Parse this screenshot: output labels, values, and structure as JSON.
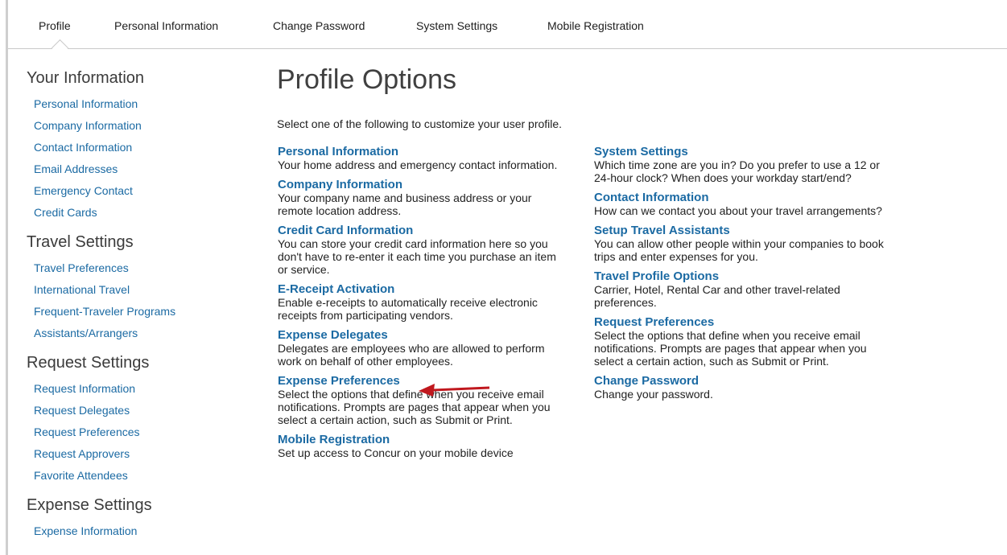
{
  "tabs": [
    {
      "label": "Profile"
    },
    {
      "label": "Personal Information"
    },
    {
      "label": "Change Password"
    },
    {
      "label": "System Settings"
    },
    {
      "label": "Mobile Registration"
    }
  ],
  "sidebar": {
    "groups": [
      {
        "heading": "Your Information",
        "items": [
          {
            "label": "Personal Information"
          },
          {
            "label": "Company Information"
          },
          {
            "label": "Contact Information"
          },
          {
            "label": "Email Addresses"
          },
          {
            "label": "Emergency Contact"
          },
          {
            "label": "Credit Cards"
          }
        ]
      },
      {
        "heading": "Travel Settings",
        "items": [
          {
            "label": "Travel Preferences"
          },
          {
            "label": "International Travel"
          },
          {
            "label": "Frequent-Traveler Programs"
          },
          {
            "label": "Assistants/Arrangers"
          }
        ]
      },
      {
        "heading": "Request Settings",
        "items": [
          {
            "label": "Request Information"
          },
          {
            "label": "Request Delegates"
          },
          {
            "label": "Request Preferences"
          },
          {
            "label": "Request Approvers"
          },
          {
            "label": "Favorite Attendees"
          }
        ]
      },
      {
        "heading": "Expense Settings",
        "items": [
          {
            "label": "Expense Information"
          }
        ]
      }
    ]
  },
  "main": {
    "title": "Profile Options",
    "intro": "Select one of the following to customize your user profile.",
    "left_options": [
      {
        "title": "Personal Information",
        "desc": "Your home address and emergency contact information."
      },
      {
        "title": "Company Information",
        "desc": "Your company name and business address or your remote location address."
      },
      {
        "title": "Credit Card Information",
        "desc": "You can store your credit card information here so you don't have to re-enter it each time you purchase an item or service."
      },
      {
        "title": "E-Receipt Activation",
        "desc": "Enable e-receipts to automatically receive electronic receipts from participating vendors."
      },
      {
        "title": "Expense Delegates",
        "desc": "Delegates are employees who are allowed to perform work on behalf of other employees."
      },
      {
        "title": "Expense Preferences",
        "desc": "Select the options that define when you receive email notifications. Prompts are pages that appear when you select a certain action, such as Submit or Print."
      },
      {
        "title": "Mobile Registration",
        "desc": "Set up access to Concur on your mobile device"
      }
    ],
    "right_options": [
      {
        "title": "System Settings",
        "desc": "Which time zone are you in? Do you prefer to use a 12 or 24-hour clock? When does your workday start/end?"
      },
      {
        "title": "Contact Information",
        "desc": "How can we contact you about your travel arrangements?"
      },
      {
        "title": "Setup Travel Assistants",
        "desc": "You can allow other people within your companies to book trips and enter expenses for you."
      },
      {
        "title": "Travel Profile Options",
        "desc": "Carrier, Hotel, Rental Car and other travel-related preferences."
      },
      {
        "title": "Request Preferences",
        "desc": "Select the options that define when you receive email notifications. Prompts are pages that appear when you select a certain action, such as Submit or Print."
      },
      {
        "title": "Change Password",
        "desc": "Change your password."
      }
    ]
  },
  "colors": {
    "link": "#1b6aa3",
    "arrow": "#c0181e"
  },
  "annotation": {
    "icon": "red-arrow-icon"
  }
}
